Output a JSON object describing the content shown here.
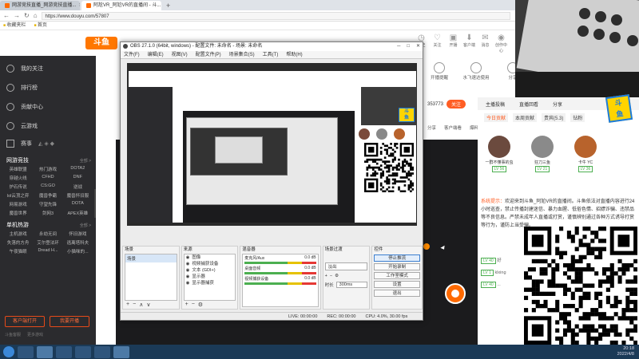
{
  "browser": {
    "tabs": [
      {
        "title": "网游竞技直播_网游竞技直播...",
        "active": false
      },
      {
        "title": "阿尬VR_阿尬VR的直播间 - 斗...",
        "active": true
      }
    ],
    "new_tab": "+",
    "url": "https://www.douyu.com/57807",
    "bookmarks": [
      "收藏夹栏",
      "首页"
    ]
  },
  "site": {
    "logo": "斗鱼",
    "header_icons": [
      {
        "icon": "history-icon",
        "label": "历史"
      },
      {
        "icon": "follow-icon",
        "label": "关注"
      },
      {
        "icon": "start-live-icon",
        "label": "开播"
      },
      {
        "icon": "client-icon",
        "label": "客户端"
      },
      {
        "icon": "message-icon",
        "label": "消息"
      },
      {
        "icon": "creator-icon",
        "label": "创作中心"
      }
    ]
  },
  "sidebar": {
    "items": [
      {
        "icon": "heart-icon",
        "label": "我的关注"
      },
      {
        "icon": "rank-icon",
        "label": "排行榜"
      },
      {
        "icon": "guild-icon",
        "label": "贡献中心"
      },
      {
        "icon": "cloud-game-icon",
        "label": "云游戏"
      }
    ],
    "match_row": "赛事",
    "section1": {
      "title": "网游竞技",
      "more": "全部 >",
      "games": [
        "英雄联盟",
        "热门游戏",
        "DOTA2",
        "穿越火线",
        "CFHD",
        "DNF",
        "炉石传说",
        "CS:GO",
        "逆战",
        "lol云顶之弈",
        "魔兽争霸",
        "魔兽怀旧服",
        "网易游戏",
        "守望先锋",
        "DOTA",
        "魔兽世界",
        "剑网3",
        "APEX英雄"
      ]
    },
    "section2": {
      "title": "单机热游",
      "more": "全部 >",
      "games": [
        "主机游戏",
        "永劫无间",
        "怀旧游戏",
        "失落的方舟",
        "艾尔登法环",
        "逃离塔科夫",
        "午夜猫眼",
        "Dread H...",
        "小猫咪的..."
      ]
    },
    "buttons": [
      "客户端打开",
      "我要开播"
    ],
    "footer": [
      "斗鱼客服",
      "更多游戏"
    ]
  },
  "room": {
    "controls": [
      {
        "icon": "broadcast-icon",
        "label": "开播提醒"
      },
      {
        "icon": "plane-icon",
        "label": "水飞速达使用"
      },
      {
        "icon": "share-icon",
        "label": "分享"
      }
    ],
    "fans_count": "353773",
    "follow_label": "关注",
    "share_row": [
      "分享",
      "客户端看",
      "爆料投诉"
    ]
  },
  "obs": {
    "title": "OBS 27.1.0 (64bit, windows) - 配置文件: 未命名 - 场景: 未命名",
    "menu": [
      "文件(F)",
      "编辑(E)",
      "视图(V)",
      "配置文件(P)",
      "场景集合(S)",
      "工具(T)",
      "帮助(H)"
    ],
    "panels": {
      "scenes": {
        "title": "场景",
        "items": [
          "场景"
        ]
      },
      "sources": {
        "title": "来源",
        "items": [
          "图像",
          "视频捕获设备",
          "文本 (GDI+)",
          "显示器",
          "显示器捕获"
        ]
      },
      "mixer": {
        "title": "混音器",
        "channels": [
          {
            "name": "麦克风/Aux",
            "db": "0.0 dB"
          },
          {
            "name": "桌面音频",
            "db": "0.0 dB"
          },
          {
            "name": "视频捕获设备",
            "db": "0.0 dB"
          }
        ]
      },
      "transitions": {
        "title": "场景过渡",
        "mode": "淡出",
        "duration_label": "时长",
        "duration": "300ms"
      },
      "controls": {
        "title": "控件",
        "buttons": [
          "停止推流",
          "开始录制",
          "工作室模式",
          "设置",
          "退出"
        ]
      }
    },
    "status": [
      "LIVE: 00:00:00",
      "REC: 00:00:00",
      "CPU: 4.0%, 30.00 fps"
    ]
  },
  "room_panel": {
    "top_tabs": [
      "主播投稿",
      "直播回看",
      "分享"
    ],
    "tabs": [
      "今日贡献",
      "本周贡献",
      "贵宾(5.3)",
      "钻粉"
    ],
    "rank": [
      {
        "name": "一群不懂事的虫",
        "level": "LV 56"
      },
      {
        "name": "狂刀三鱼",
        "level": "LV 21"
      },
      {
        "name": "卡牛 YC",
        "level": "LV 36"
      }
    ],
    "sys_label": "系统提示：",
    "sys_text": "欢迎来到斗鱼_阿尬VR的直播间。斗鱼依法对直播内容进行24小时巡查，禁止传播封建迷信、暴力血腥、低俗色情、招嫖诈骗、违禁品等不良信息。严禁未成年人直播或打赏，谨慎辨别通过各种方式诱导打赏等行为，谨防上当受骗。",
    "chat": [
      {
        "level": "LV 40",
        "name": "好"
      },
      {
        "level": "LV 1",
        "name": "klxing"
      },
      {
        "level": "LV 40",
        "name": "..."
      }
    ]
  },
  "taskbar": {
    "time": "20:18",
    "date": "2022/4/8"
  },
  "colors": {
    "brand": "#ff6a00",
    "sidebar_bg": "#2b2b2e",
    "accent_red": "#ff5d23"
  }
}
